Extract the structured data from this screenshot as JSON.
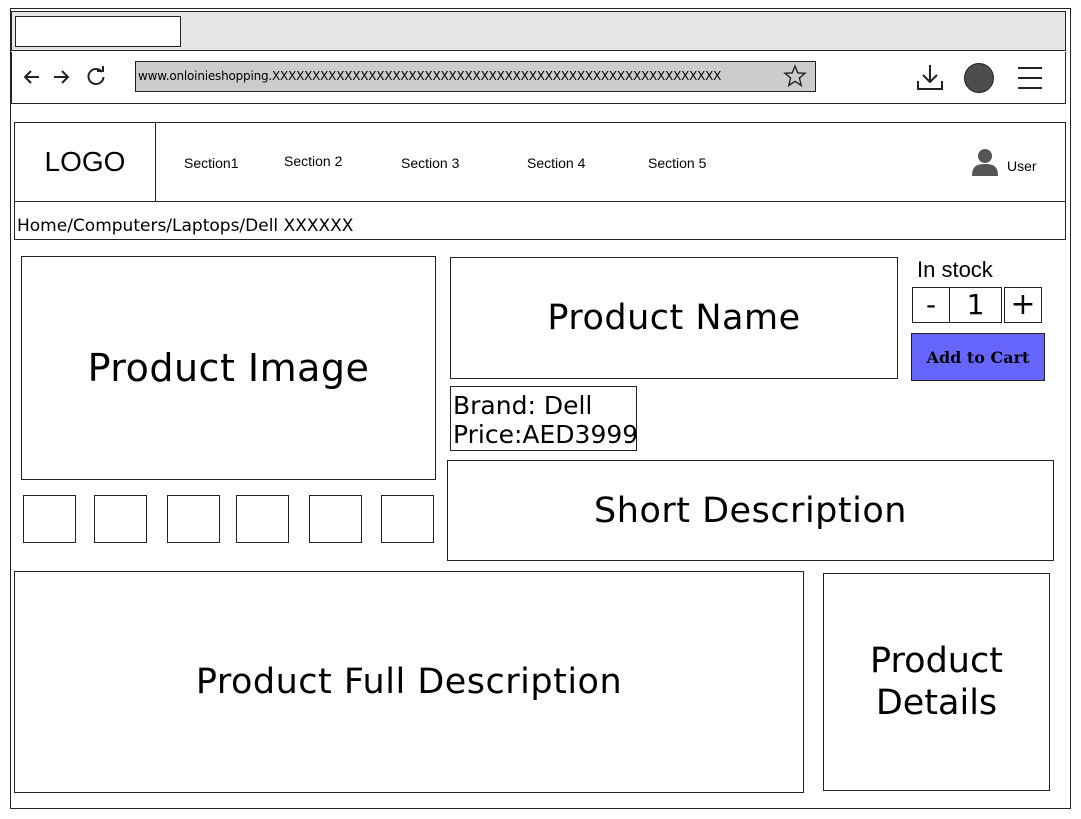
{
  "browser": {
    "tab_label": "",
    "address_url": "www.onloinieshopping.XXXXXXXXXXXXXXXXXXXXXXXXXXXXXXXXXXXXXXXXXXXXXXXXXXXXXXXX",
    "icons": [
      "back-arrow-icon",
      "forward-arrow-icon",
      "reload-icon",
      "star-icon",
      "download-icon",
      "profile-circle-icon",
      "hamburger-menu-icon"
    ]
  },
  "header": {
    "logo": "LOGO",
    "sections": [
      "Section1",
      "Section 2",
      "Section 3",
      "Section 4",
      "Section 5"
    ],
    "user_label": "User",
    "user_icon": "user-icon"
  },
  "breadcrumb": "Home/Computers/Laptops/Dell XXXXXX",
  "product": {
    "image_label": "Product Image",
    "name_label": "Product Name",
    "brand": "Brand: Dell",
    "price": "Price:AED3999",
    "stock_status": "In stock",
    "quantity": "1",
    "minus_label": "-",
    "plus_label": "+",
    "add_to_cart": "Add to Cart",
    "short_description": "Short Description",
    "full_description": "Product Full Description",
    "details_line1": "Product",
    "details_line2": "Details"
  },
  "colors": {
    "chrome_bg": "#e6e6e6",
    "address_bg": "#cccccc",
    "cart_button": "#6666ff",
    "profile_circle": "#4d4d4d",
    "user_icon": "#555555"
  }
}
